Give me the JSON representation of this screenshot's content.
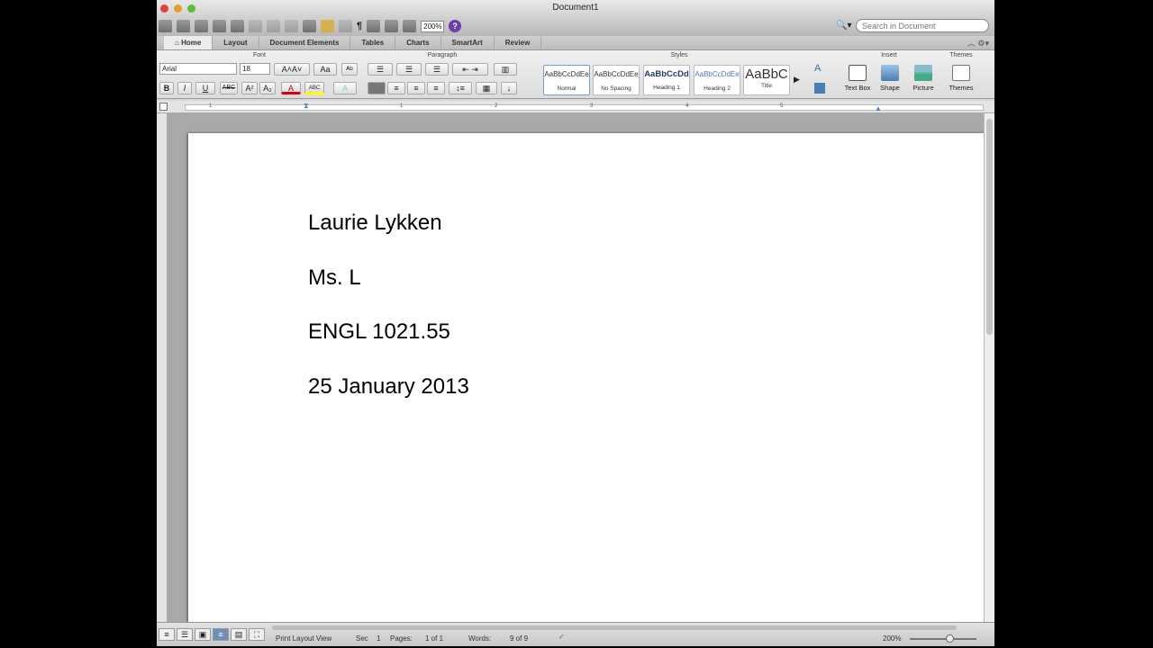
{
  "window": {
    "title": "Document1"
  },
  "toolbar": {
    "zoom": "200%",
    "help": "?"
  },
  "search": {
    "placeholder": "Search in Document"
  },
  "tabs": [
    "Home",
    "Layout",
    "Document Elements",
    "Tables",
    "Charts",
    "SmartArt",
    "Review"
  ],
  "ribbon": {
    "groups": {
      "font": "Font",
      "paragraph": "Paragraph",
      "styles": "Styles",
      "insert": "Insert",
      "themes": "Themes"
    },
    "font_name": "Arial",
    "font_size": "18",
    "font_buttons": [
      "B",
      "I",
      "U",
      "ABC",
      "A²",
      "A₂"
    ],
    "styles": [
      {
        "preview": "AaBbCcDdEe",
        "name": "Normal"
      },
      {
        "preview": "AaBbCcDdEe",
        "name": "No Spacing"
      },
      {
        "preview": "AaBbCcDd",
        "name": "Heading 1"
      },
      {
        "preview": "AaBbCcDdEe",
        "name": "Heading 2"
      },
      {
        "preview": "AaBbC",
        "name": "Title"
      }
    ],
    "insert": [
      "Text Box",
      "Shape",
      "Picture"
    ],
    "themes": "Themes"
  },
  "ruler": [
    "1",
    "1",
    "2",
    "3",
    "4",
    "5"
  ],
  "document": {
    "lines": [
      "Laurie Lykken",
      "Ms. L",
      "ENGL 1021.55",
      "25 January 2013"
    ]
  },
  "status": {
    "view": "Print Layout View",
    "sec_label": "Sec",
    "sec": "1",
    "pages_label": "Pages:",
    "pages": "1 of 1",
    "words_label": "Words:",
    "words": "9 of 9",
    "zoom": "200%"
  },
  "colors": {
    "accent": "#6f8fb5",
    "help": "#6a3fa8"
  }
}
